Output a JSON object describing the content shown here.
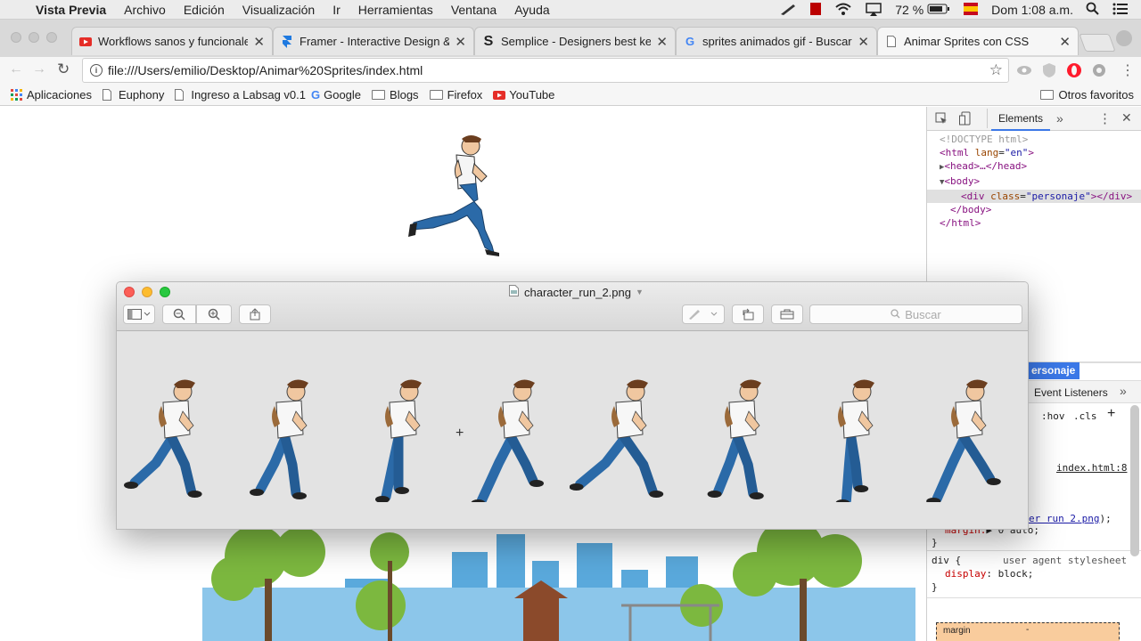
{
  "menubar": {
    "app": "Vista Previa",
    "items": [
      "Archivo",
      "Edición",
      "Visualización",
      "Ir",
      "Herramientas",
      "Ventana",
      "Ayuda"
    ],
    "battery": "72 %",
    "clock": "Dom 1:08 a.m."
  },
  "tabs": [
    {
      "title": "Workflows sanos y funcionales",
      "icon": "youtube-icon"
    },
    {
      "title": "Framer - Interactive Design &",
      "icon": "framer-icon"
    },
    {
      "title": "Semplice - Designers best kep",
      "icon": "semplice-icon"
    },
    {
      "title": "sprites animados gif - Buscar",
      "icon": "google-icon"
    },
    {
      "title": "Animar Sprites con CSS",
      "icon": "page-icon"
    }
  ],
  "address": {
    "url": "file:///Users/emilio/Desktop/Animar%20Sprites/index.html"
  },
  "bookmarks": {
    "items": [
      "Aplicaciones",
      "Euphony",
      "Ingreso a Labsag v0.1",
      "Google",
      "Blogs",
      "Firefox",
      "YouTube"
    ],
    "other": "Otros favoritos"
  },
  "devtools": {
    "tab_elements": "Elements",
    "dom": {
      "doctype": "<!DOCTYPE html>",
      "html_open": "<html",
      "lang_attr": "lang",
      "lang_val": "\"en\"",
      "head": "<head>…</head>",
      "body_open": "<body>",
      "div_open": "<div",
      "class_attr": "class",
      "class_val": "\"personaje\"",
      "div_close": "></div>",
      "body_close": "</body>",
      "html_close": "</html>"
    },
    "selector_badge": "ersonaje",
    "event_listeners": "Event Listeners",
    "hov": ":hov",
    "cls": ".cls",
    "link1": "index.html:8",
    "link2": "er run 2.png",
    "after_link2": ");",
    "margin_line_prop": "margin:",
    "margin_line_val": "▶ 0 auto;",
    "brace": "}",
    "div_rule": "div {",
    "ua": "user agent stylesheet",
    "display_prop": "display",
    "display_val": "block;",
    "box_label": "margin",
    "box_dash": "-"
  },
  "preview": {
    "title": "character_run_2.png",
    "search_placeholder": "Buscar",
    "frames": 8
  },
  "colors": {
    "close": "#fc5f57",
    "minimize": "#fdbc2e",
    "zoom": "#28c840",
    "selection": "#3b78e7"
  }
}
